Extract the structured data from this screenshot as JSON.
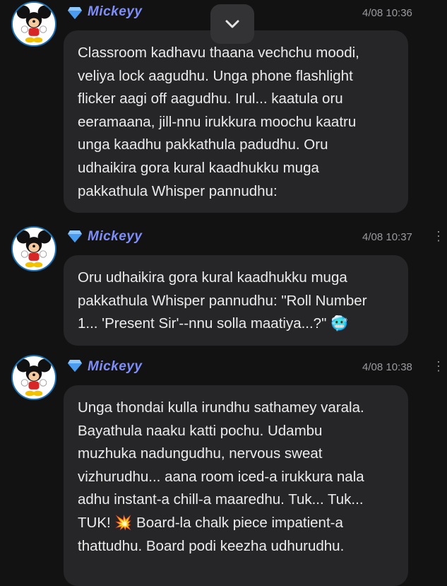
{
  "messages": [
    {
      "author": "Mickeyy",
      "time": "4/08 10:36",
      "lines": [
        "Classroom kadhavu thaana vechchu moodi,",
        "veliya lock aagudhu. Unga phone flashlight",
        "flicker aagi off aagudhu. Irul... kaatula oru",
        "eeramaana, jill-nnu irukkura moochu kaatru",
        "unga kaadhu pakkathula padudhu. Oru",
        "udhaikira gora kural kaadhukku muga",
        "pakkathula Whisper pannudhu:"
      ]
    },
    {
      "author": "Mickeyy",
      "time": "4/08 10:37",
      "lines": [
        "Oru udhaikira gora kural kaadhukku muga",
        "pakkathula Whisper pannudhu: \"Roll Number",
        "1... 'Present Sir'--nnu solla maatiya...?\""
      ],
      "trailing_emoji": "🥶"
    },
    {
      "author": "Mickeyy",
      "time": "4/08 10:38",
      "lines": [
        "Unga thondai kulla irundhu sathamey varala.",
        "Bayathula naaku katti pochu. Udambu",
        "muzhuka nadungudhu, nervous sweat",
        "vizhurudhu... aana room iced-a irukkura nala",
        "adhu instant-a chill-a maaredhu. Tuk... Tuk...",
        "Board-la chalk piece impatient-a",
        "thattudhu. Board podi keezha udhurudhu."
      ],
      "line7_prefix": "TUK!",
      "line7_emoji": "💥"
    }
  ],
  "more_glyph": "⋮",
  "scroll_icon": "chevron-down-icon"
}
